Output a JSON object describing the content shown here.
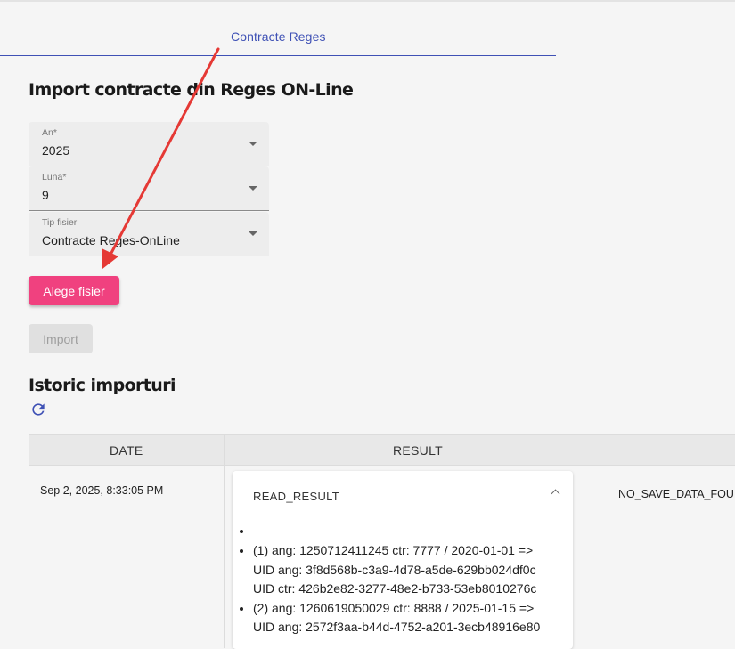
{
  "tabs": [
    {
      "label": "Contracte Reges"
    }
  ],
  "page_title": "Import contracte din Reges ON-Line",
  "form": {
    "year": {
      "label": "An*",
      "value": "2025"
    },
    "month": {
      "label": "Luna*",
      "value": "9"
    },
    "file_type": {
      "label": "Tip fisier",
      "value": "Contracte Reges-OnLine"
    }
  },
  "buttons": {
    "choose_file": "Alege fisier",
    "import": "Import"
  },
  "history": {
    "title": "Istoric importuri",
    "refresh_icon": "refresh-icon",
    "columns": [
      "DATE",
      "RESULT"
    ],
    "rows": [
      {
        "date": "Sep 2, 2025, 8:33:05 PM",
        "result": {
          "title": "READ_RESULT",
          "items": [
            "",
            "(1) ang: 1250712411245 ctr: 7777 / 2020-01-01 =>",
            "UID ang: 3f8d568b-c3a9-4d78-a5de-629bb024df0c",
            "UID ctr: 426b2e82-3277-48e2-b733-53eb8010276c",
            "(2) ang: 1260619050029 ctr: 8888 / 2025-01-15 =>",
            "UID ang: 2572f3aa-b44d-4752-a201-3ecb48916e80"
          ]
        },
        "status": "NO_SAVE_DATA_FOU"
      }
    ]
  },
  "colors": {
    "accent": "#3f51b5",
    "primary_button": "#f0417f",
    "annotation_arrow": "#e53935"
  }
}
